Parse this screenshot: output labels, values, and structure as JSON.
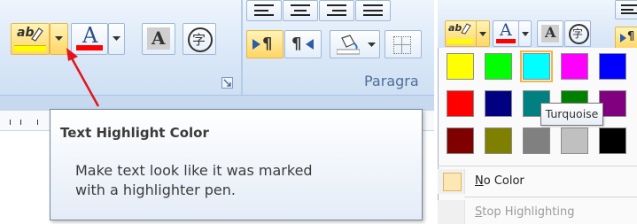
{
  "ribbon": {
    "highlight_glyph": "ab",
    "font_color_glyph": "A",
    "char_shading_glyph": "A",
    "encircle_glyph": "字",
    "paragraph_mark": "¶",
    "paragraph_group_label": "Paragra"
  },
  "tooltip": {
    "title": "Text Highlight Color",
    "body_line1": "Make text look like it was marked",
    "body_line2": "with a highlighter pen."
  },
  "palette": {
    "colors": [
      "#ffff00",
      "#00ff00",
      "#00ffff",
      "#ff00ff",
      "#0000ff",
      "#ff0000",
      "#000080",
      "#008080",
      "#008000",
      "#800080",
      "#800000",
      "#808000",
      "#808080",
      "#c0c0c0",
      "#000000"
    ],
    "selected_index": 2,
    "hover_tooltip": "Turquoise",
    "no_color_label": "No Color",
    "no_color_mnemonic": "N",
    "no_color_rest": "o Color",
    "stop_label": "Stop Highlighting",
    "stop_mnemonic": "S",
    "stop_rest": "top Highlighting"
  },
  "colors": {
    "highlight_yellow": "#ffff00",
    "font_red": "#ff0000",
    "arrow_red": "#e3131b",
    "selection_outline": "#f2b64b"
  }
}
